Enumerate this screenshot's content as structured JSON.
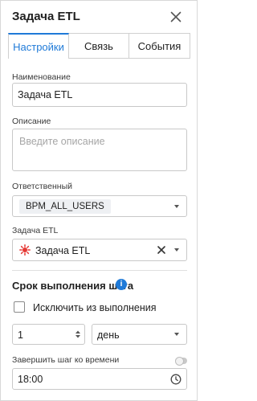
{
  "window": {
    "title": "Задача ETL"
  },
  "tabs": [
    {
      "label": "Настройки",
      "active": true
    },
    {
      "label": "Связь",
      "active": false
    },
    {
      "label": "События",
      "active": false
    }
  ],
  "form": {
    "name": {
      "label": "Наименование",
      "value": "Задача ETL"
    },
    "description": {
      "label": "Описание",
      "placeholder": "Введите описание"
    },
    "responsible": {
      "label": "Ответственный",
      "value": "BPM_ALL_USERS"
    },
    "etl_task": {
      "label": "Задача ETL",
      "value": "Задача ETL"
    }
  },
  "deadline": {
    "title": "Срок выполнения шага",
    "exclude_label": "Исключить из выполнения",
    "exclude_checked": false,
    "amount": "1",
    "unit": "день",
    "finish_label": "Завершить шаг ко времени",
    "finish_enabled": false,
    "time": "18:00"
  },
  "colors": {
    "accent": "#1f7ad8",
    "border": "#c8c8c8",
    "etl_icon": "#e53935"
  },
  "icons": [
    "close-icon",
    "info-icon",
    "etl-task-icon",
    "clear-icon",
    "chevron-down-icon",
    "stepper-icon",
    "clock-icon"
  ]
}
